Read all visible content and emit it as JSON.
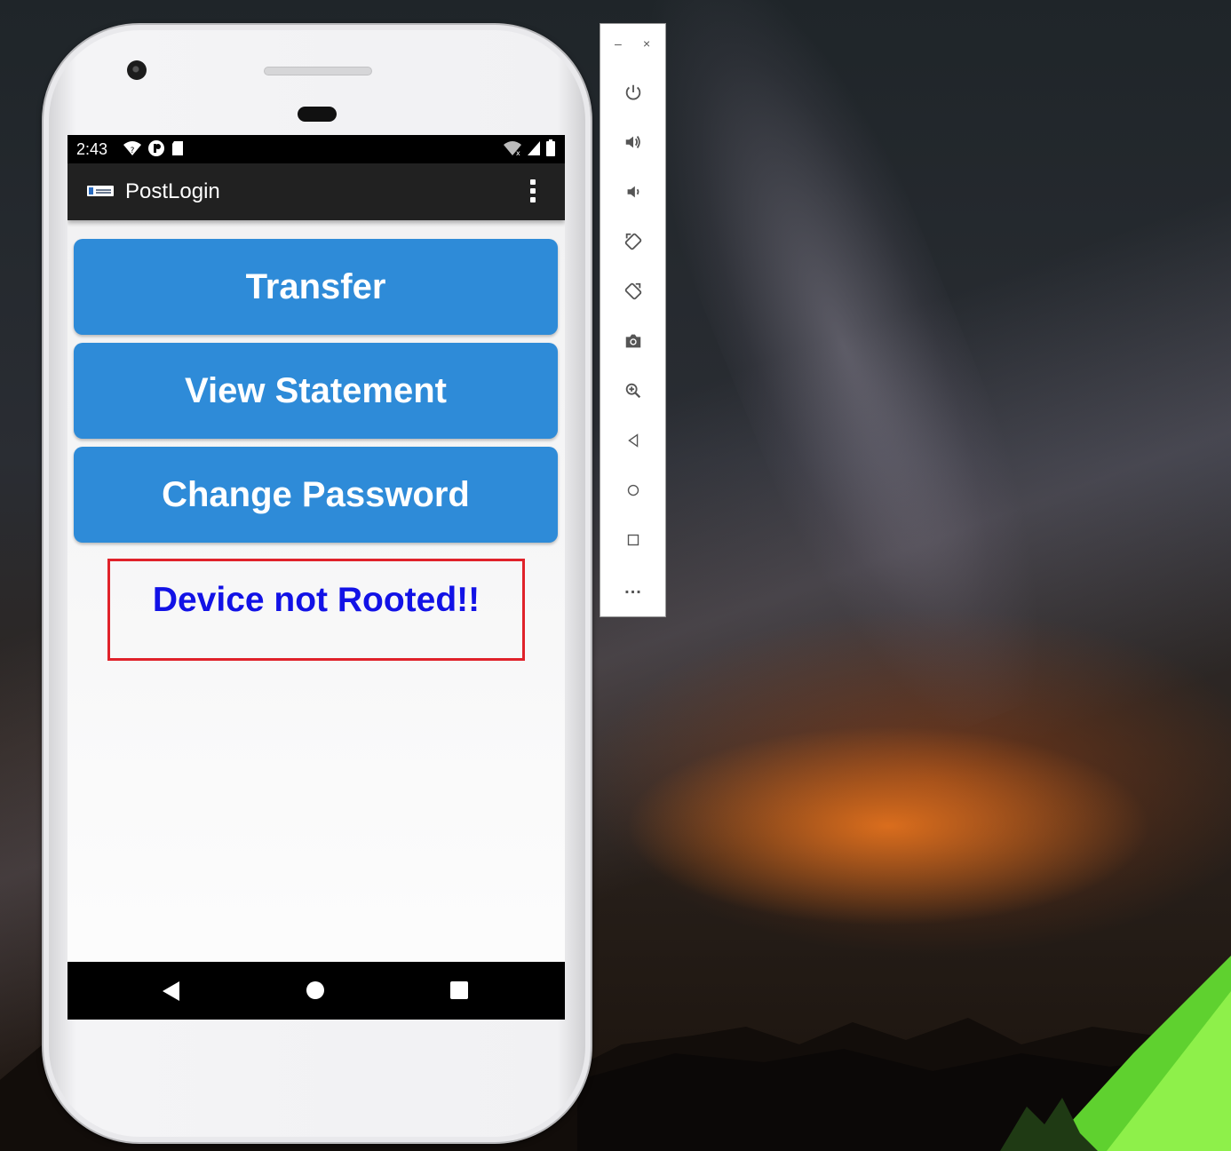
{
  "status_bar": {
    "time": "2:43"
  },
  "app_bar": {
    "title": "PostLogin"
  },
  "buttons": {
    "transfer": "Transfer",
    "view_statement": "View Statement",
    "change_password": "Change Password"
  },
  "root_status": {
    "message": "Device not Rooted!!"
  },
  "emulator_toolbar": {
    "minimize_label": "–",
    "close_label": "×",
    "more_label": "..."
  },
  "colors": {
    "button_blue": "#2e8bd8",
    "message_blue": "#1212e6",
    "highlight_red": "#e0222a",
    "app_bar": "#212121"
  }
}
